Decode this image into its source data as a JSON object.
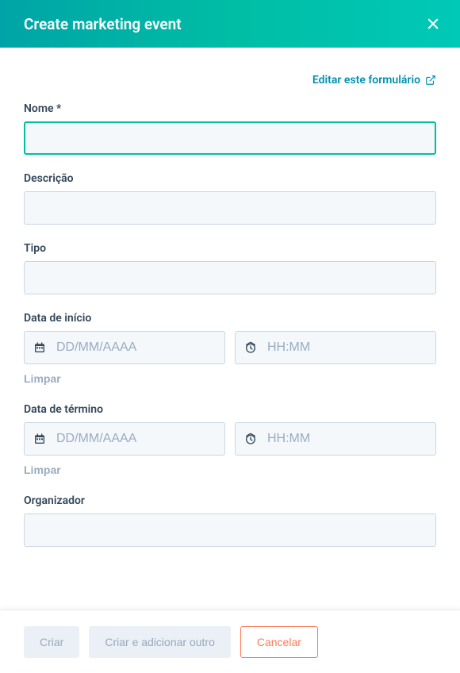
{
  "header": {
    "title": "Create marketing event"
  },
  "editForm": {
    "label": "Editar este formulário"
  },
  "fields": {
    "name": {
      "label": "Nome *"
    },
    "description": {
      "label": "Descrição"
    },
    "type": {
      "label": "Tipo"
    },
    "startDate": {
      "label": "Data de início",
      "datePlaceholder": "DD/MM/AAAA",
      "timePlaceholder": "HH:MM",
      "clearLabel": "Limpar"
    },
    "endDate": {
      "label": "Data de término",
      "datePlaceholder": "DD/MM/AAAA",
      "timePlaceholder": "HH:MM",
      "clearLabel": "Limpar"
    },
    "organizer": {
      "label": "Organizador"
    }
  },
  "footer": {
    "createLabel": "Criar",
    "createAnotherLabel": "Criar e adicionar outro",
    "cancelLabel": "Cancelar"
  }
}
